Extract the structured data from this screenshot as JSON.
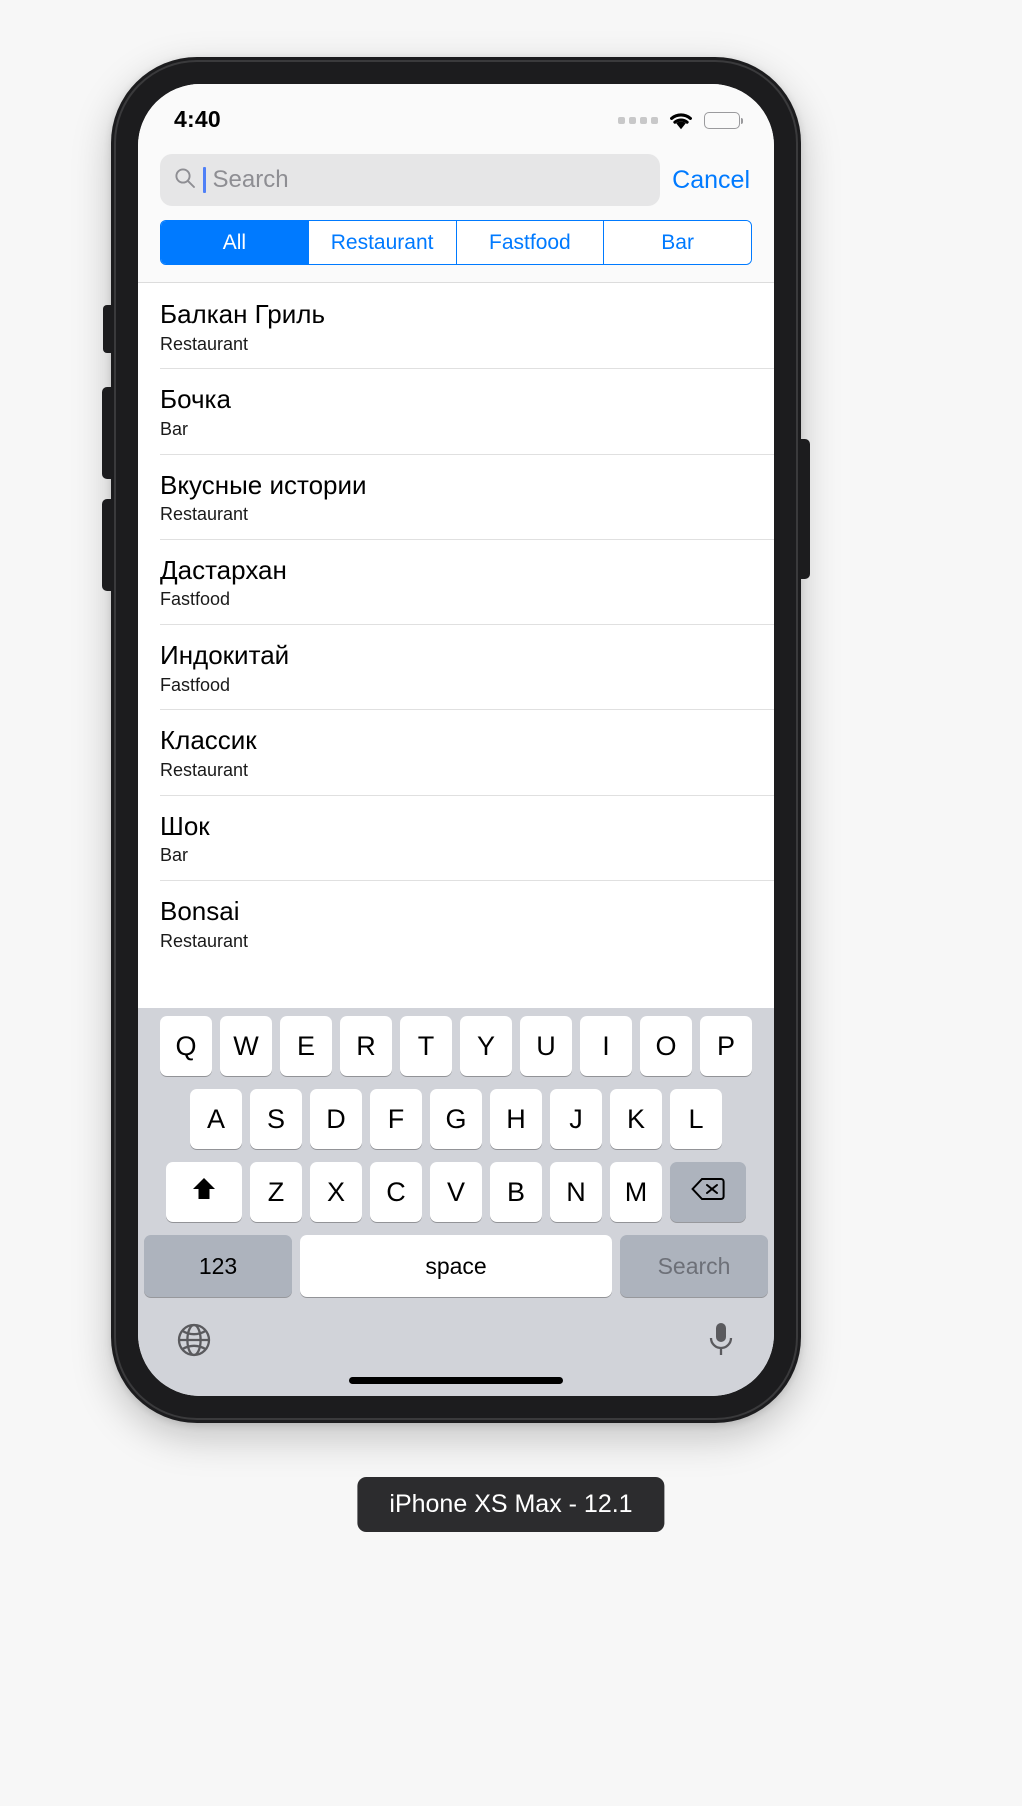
{
  "device": {
    "label": "iPhone XS Max - 12.1"
  },
  "status_bar": {
    "time": "4:40",
    "cellular_icon": "cellular-dots-icon",
    "wifi_icon": "wifi-icon",
    "battery_icon": "battery-icon",
    "battery_level_percent": 72
  },
  "search": {
    "placeholder": "Search",
    "value": "",
    "icon": "search-icon",
    "cancel_label": "Cancel"
  },
  "segmented_control": {
    "selected_index": 0,
    "options": [
      {
        "label": "All"
      },
      {
        "label": "Restaurant"
      },
      {
        "label": "Fastfood"
      },
      {
        "label": "Bar"
      }
    ]
  },
  "list": {
    "items": [
      {
        "title": "Балкан Гриль",
        "subtitle": "Restaurant"
      },
      {
        "title": "Бочка",
        "subtitle": "Bar"
      },
      {
        "title": "Вкусные истории",
        "subtitle": "Restaurant"
      },
      {
        "title": "Дастархан",
        "subtitle": "Fastfood"
      },
      {
        "title": "Индокитай",
        "subtitle": "Fastfood"
      },
      {
        "title": "Классик",
        "subtitle": "Restaurant"
      },
      {
        "title": "Шок",
        "subtitle": "Bar"
      },
      {
        "title": "Bonsai",
        "subtitle": "Restaurant"
      }
    ]
  },
  "keyboard": {
    "row1": [
      "Q",
      "W",
      "E",
      "R",
      "T",
      "Y",
      "U",
      "I",
      "O",
      "P"
    ],
    "row2": [
      "A",
      "S",
      "D",
      "F",
      "G",
      "H",
      "J",
      "K",
      "L"
    ],
    "row3": [
      "Z",
      "X",
      "C",
      "V",
      "B",
      "N",
      "M"
    ],
    "shift_icon": "shift-arrow-icon",
    "backspace_icon": "backspace-icon",
    "numbers_label": "123",
    "space_label": "space",
    "return_label": "Search",
    "globe_icon": "globe-icon",
    "microphone_icon": "microphone-icon"
  },
  "colors": {
    "accent": "#007aff",
    "keyboard_bg": "#d1d3d9",
    "search_field_bg": "#e6e6e7",
    "placeholder_text": "#8e8e93"
  }
}
